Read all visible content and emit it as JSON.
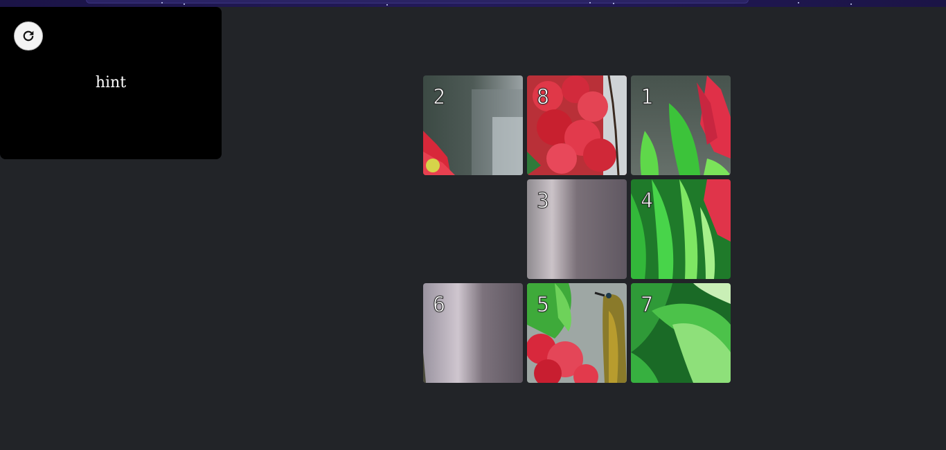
{
  "hint_panel": {
    "label": "hint",
    "refresh_icon": "refresh-icon"
  },
  "board": {
    "size": 3,
    "tiles": [
      {
        "number": "2",
        "row": 0,
        "col": 0
      },
      {
        "number": "8",
        "row": 0,
        "col": 1
      },
      {
        "number": "1",
        "row": 0,
        "col": 2
      },
      {
        "number": "3",
        "row": 1,
        "col": 1
      },
      {
        "number": "4",
        "row": 1,
        "col": 2
      },
      {
        "number": "6",
        "row": 2,
        "col": 0
      },
      {
        "number": "5",
        "row": 2,
        "col": 1
      },
      {
        "number": "7",
        "row": 2,
        "col": 2
      }
    ],
    "empty": {
      "row": 1,
      "col": 0
    }
  }
}
